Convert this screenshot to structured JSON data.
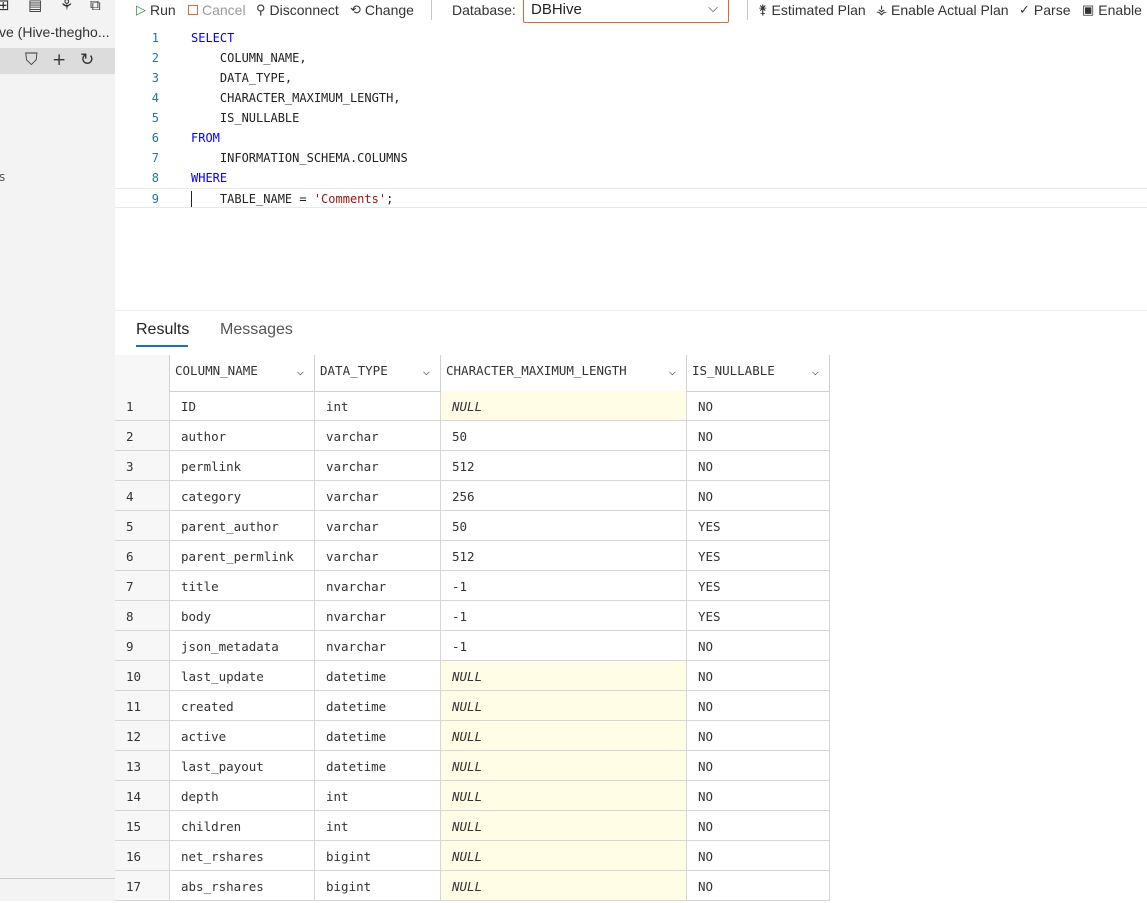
{
  "sidebar": {
    "connection_name": "ve (Hive-thegho...",
    "stray_text": "s"
  },
  "toolbar": {
    "run": "Run",
    "cancel": "Cancel",
    "disconnect": "Disconnect",
    "change": "Change",
    "database_label": "Database:",
    "database_value": "DBHive",
    "estimated_plan": "Estimated Plan",
    "enable_actual_plan": "Enable Actual Plan",
    "parse": "Parse",
    "enable": "Enable"
  },
  "editor": {
    "lines": [
      {
        "n": "1",
        "kw": "SELECT",
        "text": "",
        "str": "",
        "tail": ""
      },
      {
        "n": "2",
        "kw": "",
        "text": "    COLUMN_NAME,",
        "str": "",
        "tail": ""
      },
      {
        "n": "3",
        "kw": "",
        "text": "    DATA_TYPE,",
        "str": "",
        "tail": ""
      },
      {
        "n": "4",
        "kw": "",
        "text": "    CHARACTER_MAXIMUM_LENGTH,",
        "str": "",
        "tail": ""
      },
      {
        "n": "5",
        "kw": "",
        "text": "    IS_NULLABLE",
        "str": "",
        "tail": ""
      },
      {
        "n": "6",
        "kw": "FROM",
        "text": "",
        "str": "",
        "tail": ""
      },
      {
        "n": "7",
        "kw": "",
        "text": "    INFORMATION_SCHEMA.COLUMNS",
        "str": "",
        "tail": ""
      },
      {
        "n": "8",
        "kw": "WHERE",
        "text": "",
        "str": "",
        "tail": ""
      },
      {
        "n": "9",
        "kw": "",
        "text": "    TABLE_NAME = ",
        "str": "'Comments'",
        "tail": ";"
      }
    ]
  },
  "results": {
    "tabs": [
      "Results",
      "Messages"
    ],
    "columns": [
      "COLUMN_NAME",
      "DATA_TYPE",
      "CHARACTER_MAXIMUM_LENGTH",
      "IS_NULLABLE"
    ],
    "rows": [
      [
        "1",
        "ID",
        "int",
        "NULL",
        "NO"
      ],
      [
        "2",
        "author",
        "varchar",
        "50",
        "NO"
      ],
      [
        "3",
        "permlink",
        "varchar",
        "512",
        "NO"
      ],
      [
        "4",
        "category",
        "varchar",
        "256",
        "NO"
      ],
      [
        "5",
        "parent_author",
        "varchar",
        "50",
        "YES"
      ],
      [
        "6",
        "parent_permlink",
        "varchar",
        "512",
        "YES"
      ],
      [
        "7",
        "title",
        "nvarchar",
        "-1",
        "YES"
      ],
      [
        "8",
        "body",
        "nvarchar",
        "-1",
        "YES"
      ],
      [
        "9",
        "json_metadata",
        "nvarchar",
        "-1",
        "NO"
      ],
      [
        "10",
        "last_update",
        "datetime",
        "NULL",
        "NO"
      ],
      [
        "11",
        "created",
        "datetime",
        "NULL",
        "NO"
      ],
      [
        "12",
        "active",
        "datetime",
        "NULL",
        "NO"
      ],
      [
        "13",
        "last_payout",
        "datetime",
        "NULL",
        "NO"
      ],
      [
        "14",
        "depth",
        "int",
        "NULL",
        "NO"
      ],
      [
        "15",
        "children",
        "int",
        "NULL",
        "NO"
      ],
      [
        "16",
        "net_rshares",
        "bigint",
        "NULL",
        "NO"
      ],
      [
        "17",
        "abs_rshares",
        "bigint",
        "NULL",
        "NO"
      ]
    ]
  }
}
